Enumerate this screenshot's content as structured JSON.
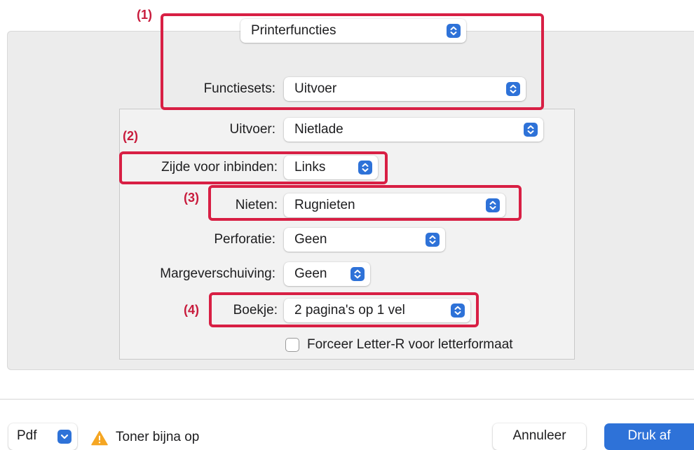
{
  "callout_numbers": [
    "(1)",
    "(2)",
    "(3)",
    "(4)"
  ],
  "printer_functions": {
    "value": "Printerfuncties"
  },
  "function_sets": {
    "label": "Functiesets:",
    "value": "Uitvoer"
  },
  "output": {
    "label": "Uitvoer:",
    "value": "Nietlade"
  },
  "binding_side": {
    "label": "Zijde voor inbinden:",
    "value": "Links"
  },
  "stapling": {
    "label": "Nieten:",
    "value": "Rugnieten"
  },
  "punch": {
    "label": "Perforatie:",
    "value": "Geen"
  },
  "margin_shift": {
    "label": "Margeverschuiving:",
    "value": "Geen"
  },
  "booklet": {
    "label": "Boekje:",
    "value": "2 pagina's op 1 vel"
  },
  "force_letter_r": {
    "label": "Forceer Letter-R voor letterformaat",
    "checked": false
  },
  "footer": {
    "pdf_label": "Pdf",
    "warning_text": "Toner bijna op",
    "cancel_label": "Annuleer",
    "print_label": "Druk af"
  },
  "colors": {
    "accent": "#2e72d8",
    "callout": "#d81f44",
    "warning": "#f5a623"
  },
  "icons": [
    "chevron-updown-icon",
    "chevron-down-icon",
    "warning-icon"
  ]
}
